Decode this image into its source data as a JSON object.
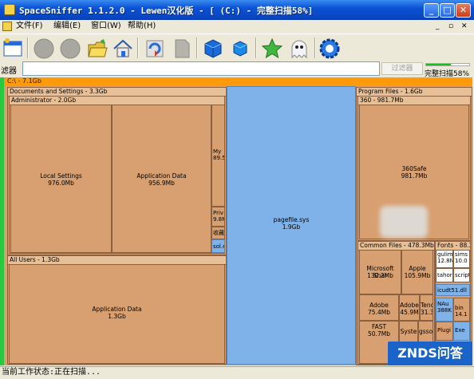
{
  "window": {
    "title": "SpaceSniffer 1.1.2.0 - Lewen汉化版 - [ (C:) - 完整扫描58%]",
    "controls": {
      "minimize": "_",
      "maximize": "□",
      "close": "✕"
    },
    "mdi_controls": {
      "minimize": "_",
      "restore": "▫",
      "close": "✕"
    }
  },
  "menu": {
    "items": [
      "文件(F)",
      "编辑(E)",
      "窗口(W)",
      "帮助(H)"
    ]
  },
  "toolbar": {
    "icons": [
      "new-window-icon",
      "circle-gray-icon",
      "circle-gray-icon",
      "open-folder-icon",
      "home-icon",
      "refresh-icon",
      "document-gray-icon",
      "blue-cube-icon",
      "blue-cube-small-icon",
      "green-star-icon",
      "ghost-icon",
      "gear-blue-icon"
    ]
  },
  "filter": {
    "label": "滤器",
    "value": "",
    "button": "过滤器",
    "progress": 0.58,
    "status": "完整扫描58%"
  },
  "map": {
    "root": "C:\\ - 7.1Gb",
    "docs": "Documents and Settings - 3.3Gb",
    "admin": "Administrator - 2.0Gb",
    "local_settings": {
      "name": "Local Settings",
      "size": "976.0Mb"
    },
    "app_data_admin": {
      "name": "Application Data",
      "size": "956.9Mb"
    },
    "my": {
      "name": "My",
      "size": "89.5"
    },
    "priv": {
      "name": "Priv",
      "size": "9.8M"
    },
    "fav": "收藏",
    "sol": "sol.e",
    "all_users": "All Users - 1.3Gb",
    "app_data_all": {
      "name": "Application Data",
      "size": "1.3Gb"
    },
    "pagefile": {
      "name": "pagefile.sys",
      "size": "1.9Gb"
    },
    "program_files": "Program Files - 1.6Gb",
    "p360": "360 - 981.7Mb",
    "safe360": {
      "name": "360Safe",
      "size": "981.7Mb"
    },
    "common_files": "Common Files - 478.3Mb",
    "ms_shared": {
      "name": "Microsoft Shar",
      "size": "130.2Mb"
    },
    "apple": {
      "name": "Apple",
      "size": "105.9Mb"
    },
    "adobe1": {
      "name": "Adobe",
      "size": "75.4Mb"
    },
    "adobe2": {
      "name": "Adobe",
      "size": "45.9M"
    },
    "tenc": {
      "name": "Tenc",
      "size": "31.3"
    },
    "fast": {
      "name": "FAST",
      "size": "50.7Mb"
    },
    "syste": "Syste",
    "gssof": "gssof",
    "fonts": "Fonts - 88.3",
    "gulim": {
      "name": "gulim",
      "size": "12.8M"
    },
    "sims": {
      "name": "sims",
      "size": "10.0"
    },
    "tahor": "tahor",
    "script": "script",
    "icudt": "icudt51.dll",
    "nau": {
      "name": "NAu",
      "size": "388K"
    },
    "bin": {
      "name": "bin",
      "size": "14.1"
    },
    "plugi": "Plugi",
    "exe": "Exe"
  },
  "statusbar": {
    "text": "当前工作状态:正在扫描..."
  },
  "watermark": {
    "text": "ZNDS问答"
  },
  "colors": {
    "title_bar": "#0a52d6",
    "root_bar": "#ff9a0a",
    "folder_fill": "#d8a070",
    "file_fill": "#7fb2e8",
    "progress": "#18c018"
  }
}
